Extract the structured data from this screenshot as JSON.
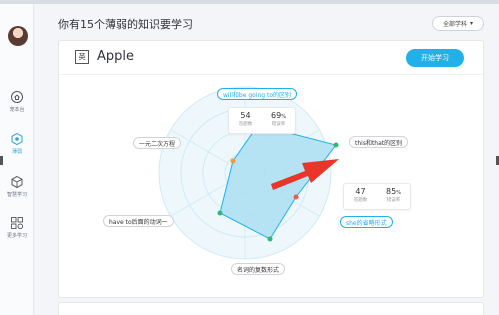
{
  "header": {
    "title": "你有15个薄弱的知识要学习"
  },
  "subject_filter": {
    "label": "全部学科",
    "arrow": "▾"
  },
  "sidebar": {
    "items": [
      {
        "label": "宠本台",
        "icon": "home-icon"
      },
      {
        "label": "薄弱",
        "icon": "weak-points-icon",
        "active": true
      },
      {
        "label": "智慧学习",
        "icon": "smart-learning-icon"
      },
      {
        "label": "更多学习",
        "icon": "more-learning-icon"
      }
    ]
  },
  "card": {
    "subject_badge": "英",
    "subject_title": "Apple",
    "start_button": "开始学习"
  },
  "radar": {
    "labels": [
      {
        "text": "will和be going to的区别",
        "highlight": true
      },
      {
        "text": "this和that的区别",
        "highlight": false
      },
      {
        "text": "she的省略形式",
        "highlight": true
      },
      {
        "text": "名词的复数形式",
        "highlight": false
      },
      {
        "text": "have to后面的动词一",
        "highlight": false
      },
      {
        "text": "一元二次方程",
        "highlight": false
      }
    ],
    "stats": [
      {
        "count": "54",
        "count_caption": "答题数",
        "rate": "69",
        "rate_unit": "%",
        "rate_caption": "错误率"
      },
      {
        "count": "47",
        "count_caption": "答题数",
        "rate": "85",
        "rate_unit": "%",
        "rate_caption": "错误率"
      }
    ],
    "colors": {
      "accent": "#21b0e8",
      "fill": "#aee0f2",
      "point_green": "#2eb872",
      "point_orange": "#f59a2f",
      "point_red": "#ef5a4b",
      "arrow": "#e8362b"
    }
  }
}
